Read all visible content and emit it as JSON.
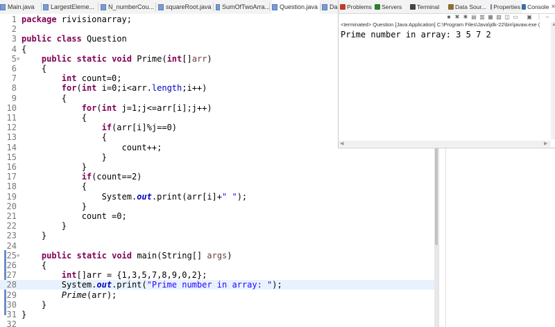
{
  "editor_tabs": [
    {
      "label": "Main.java"
    },
    {
      "label": "LargestEleme..."
    },
    {
      "label": "N_numberCou..."
    },
    {
      "label": "squareRoot.java"
    },
    {
      "label": "SumOfTwoArra..."
    },
    {
      "label": "Question.java",
      "active": true
    },
    {
      "label": "Da"
    }
  ],
  "console_tabs": [
    {
      "label": "Problems",
      "icon": "problems-icon",
      "color": "#c0392b"
    },
    {
      "label": "Servers",
      "icon": "servers-icon",
      "color": "#2e7d32"
    },
    {
      "label": "Terminal",
      "icon": "terminal-icon",
      "color": "#444444"
    },
    {
      "label": "Data Sour...",
      "icon": "database-icon",
      "color": "#8a6d3b"
    },
    {
      "label": "Properties",
      "icon": "properties-icon",
      "color": "#6b7fa8"
    },
    {
      "label": "Console",
      "icon": "console-icon",
      "color": "#3a6ea5",
      "active": true
    }
  ],
  "console": {
    "close_glyph": "✕",
    "terminated": "<terminated> Question [Java Application] C:\\Program Files\\Java\\jdk-22\\bin\\javaw.exe (",
    "output": "Prime number in array: 3 5 7 2"
  },
  "code_lines": [
    {
      "n": "1",
      "code": [
        {
          "t": "package",
          "c": "kw"
        },
        {
          "t": " rivisionarray;"
        }
      ]
    },
    {
      "n": "2",
      "code": []
    },
    {
      "n": "3",
      "code": [
        {
          "t": "public",
          "c": "kw"
        },
        {
          "t": " "
        },
        {
          "t": "class",
          "c": "kw"
        },
        {
          "t": " Question"
        }
      ]
    },
    {
      "n": "4",
      "code": [
        {
          "t": "{"
        }
      ]
    },
    {
      "n": "5",
      "fold": true,
      "code": [
        {
          "t": "    "
        },
        {
          "t": "public",
          "c": "kw"
        },
        {
          "t": " "
        },
        {
          "t": "static",
          "c": "kw"
        },
        {
          "t": " "
        },
        {
          "t": "void",
          "c": "kw"
        },
        {
          "t": " Prime("
        },
        {
          "t": "int",
          "c": "kw"
        },
        {
          "t": "[]"
        },
        {
          "t": "arr",
          "c": "var"
        },
        {
          "t": ")"
        }
      ]
    },
    {
      "n": "6",
      "code": [
        {
          "t": "    {"
        }
      ]
    },
    {
      "n": "7",
      "code": [
        {
          "t": "        "
        },
        {
          "t": "int",
          "c": "kw"
        },
        {
          "t": " count=0;"
        }
      ]
    },
    {
      "n": "8",
      "code": [
        {
          "t": "        "
        },
        {
          "t": "for",
          "c": "kw"
        },
        {
          "t": "("
        },
        {
          "t": "int",
          "c": "kw"
        },
        {
          "t": " i=0;i<arr."
        },
        {
          "t": "length",
          "c": "fld"
        },
        {
          "t": ";i++)"
        }
      ]
    },
    {
      "n": "9",
      "code": [
        {
          "t": "        {"
        }
      ]
    },
    {
      "n": "10",
      "code": [
        {
          "t": "            "
        },
        {
          "t": "for",
          "c": "kw"
        },
        {
          "t": "("
        },
        {
          "t": "int",
          "c": "kw"
        },
        {
          "t": " j=1;j<=arr[i];j++)"
        }
      ]
    },
    {
      "n": "11",
      "code": [
        {
          "t": "            {"
        }
      ]
    },
    {
      "n": "12",
      "code": [
        {
          "t": "                "
        },
        {
          "t": "if",
          "c": "kw"
        },
        {
          "t": "(arr[i]%j==0)"
        }
      ]
    },
    {
      "n": "13",
      "code": [
        {
          "t": "                {"
        }
      ]
    },
    {
      "n": "14",
      "code": [
        {
          "t": "                    count++;"
        }
      ]
    },
    {
      "n": "15",
      "code": [
        {
          "t": "                }"
        }
      ]
    },
    {
      "n": "16",
      "code": [
        {
          "t": "            }"
        }
      ]
    },
    {
      "n": "17",
      "code": [
        {
          "t": "            "
        },
        {
          "t": "if",
          "c": "kw"
        },
        {
          "t": "(count==2)"
        }
      ]
    },
    {
      "n": "18",
      "code": [
        {
          "t": "            {"
        }
      ]
    },
    {
      "n": "19",
      "code": [
        {
          "t": "                System."
        },
        {
          "t": "out",
          "c": "sfld"
        },
        {
          "t": ".print(arr[i]+"
        },
        {
          "t": "\" \"",
          "c": "str"
        },
        {
          "t": ");"
        }
      ]
    },
    {
      "n": "20",
      "code": [
        {
          "t": "            }"
        }
      ]
    },
    {
      "n": "21",
      "code": [
        {
          "t": "            count =0;"
        }
      ]
    },
    {
      "n": "22",
      "code": [
        {
          "t": "        }"
        }
      ]
    },
    {
      "n": "23",
      "code": [
        {
          "t": "    }"
        }
      ]
    },
    {
      "n": "24",
      "code": []
    },
    {
      "n": "25",
      "fold": true,
      "code": [
        {
          "t": "    "
        },
        {
          "t": "public",
          "c": "kw"
        },
        {
          "t": " "
        },
        {
          "t": "static",
          "c": "kw"
        },
        {
          "t": " "
        },
        {
          "t": "void",
          "c": "kw"
        },
        {
          "t": " main(String[] "
        },
        {
          "t": "args",
          "c": "var"
        },
        {
          "t": ")"
        }
      ]
    },
    {
      "n": "26",
      "code": [
        {
          "t": "    {"
        }
      ]
    },
    {
      "n": "27",
      "code": [
        {
          "t": "        "
        },
        {
          "t": "int",
          "c": "kw"
        },
        {
          "t": "[]arr = {1,3,5,7,8,9,0,2};"
        }
      ]
    },
    {
      "n": "28",
      "current": true,
      "code": [
        {
          "t": "        System."
        },
        {
          "t": "out",
          "c": "sfld"
        },
        {
          "t": ".print("
        },
        {
          "t": "\"Prime number in array: \"",
          "c": "str"
        },
        {
          "t": ");"
        }
      ]
    },
    {
      "n": "29",
      "code": [
        {
          "t": "        "
        },
        {
          "t": "Prime",
          "c": "smeth"
        },
        {
          "t": "(arr);"
        }
      ]
    },
    {
      "n": "30",
      "code": [
        {
          "t": "    }"
        }
      ]
    },
    {
      "n": "31",
      "code": [
        {
          "t": "}"
        }
      ]
    },
    {
      "n": "32",
      "code": []
    }
  ]
}
